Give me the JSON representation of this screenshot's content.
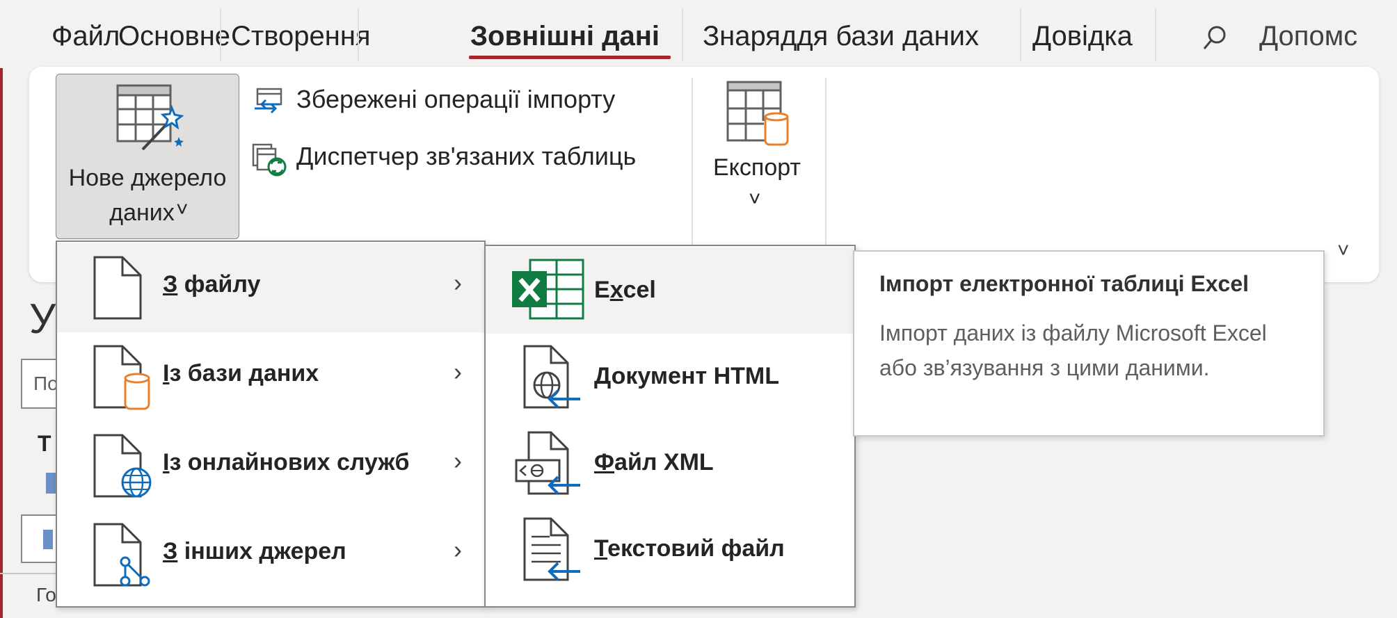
{
  "tabs": [
    {
      "label": "Файл",
      "active": false
    },
    {
      "label": "Основне",
      "active": false
    },
    {
      "label": "Створення",
      "active": false
    },
    {
      "label": "Зовнішні дані",
      "active": true
    },
    {
      "label": "Знаряддя бази даних",
      "active": false
    },
    {
      "label": "Довідка",
      "active": false
    }
  ],
  "search": {
    "icon": "search-icon",
    "label": "Допомс"
  },
  "ribbon": {
    "new_source": {
      "line1": "Нове джерело",
      "line2": "даних",
      "chevron": "˅"
    },
    "saved_imports": "Збережені операції імпорту",
    "linked_tables": "Диспетчер зв'язаних таблиць",
    "export": {
      "label": "Експорт",
      "chevron": "˅"
    },
    "collapse": "˅"
  },
  "background": {
    "heading_fragment": "У",
    "input_fragment": "По",
    "label_fragment": "Т",
    "footer_fragment": "Го"
  },
  "source_menu": {
    "items": [
      {
        "key": "З",
        "rest": " файлу",
        "icon": "file-icon",
        "arrow": "›",
        "highlighted": true
      },
      {
        "key": "І",
        "rest": "з бази даних",
        "icon": "database-file-icon",
        "arrow": "›",
        "highlighted": false
      },
      {
        "key": "І",
        "rest": "з онлайнових служб",
        "icon": "online-services-icon",
        "arrow": "›",
        "highlighted": false
      },
      {
        "key": "З",
        "rest": " інших джерел",
        "icon": "other-sources-icon",
        "arrow": "›",
        "highlighted": false
      }
    ]
  },
  "file_menu": {
    "items": [
      {
        "pre": "E",
        "key": "x",
        "rest": "cel",
        "icon": "excel-icon",
        "highlighted": true
      },
      {
        "pre": "",
        "key": "",
        "rest": "Документ HTML",
        "icon": "html-document-icon",
        "highlighted": false
      },
      {
        "pre": "",
        "key": "Ф",
        "rest": "айл XML",
        "icon": "xml-file-icon",
        "highlighted": false
      },
      {
        "pre": "",
        "key": "Т",
        "rest": "екстовий файл",
        "icon": "text-file-icon",
        "highlighted": false
      }
    ]
  },
  "tooltip": {
    "title": "Імпорт електронної таблиці Excel",
    "body": "Імпорт даних із файлу Microsoft Excel або зв’язування з цими даними."
  },
  "colors": {
    "accent": "#a4262c",
    "excel_green": "#107c41",
    "link_blue": "#0f6cbd",
    "db_orange": "#e97f2b"
  }
}
